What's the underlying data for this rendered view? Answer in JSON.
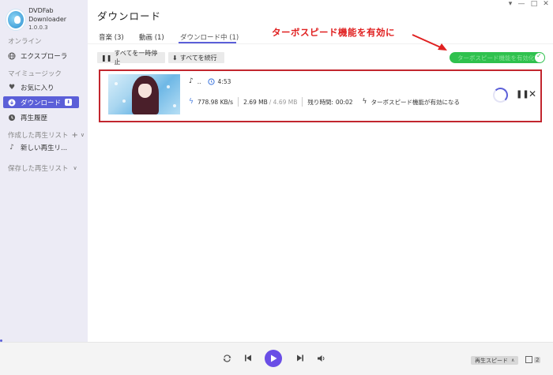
{
  "app": {
    "name": "DVDFab Downloader",
    "version": "1.0.0.3"
  },
  "window_controls": [
    "▾",
    "—",
    "□",
    "✕"
  ],
  "sidebar": {
    "online_title": "オンライン",
    "explorer_label": "エクスプローラ",
    "my_music_title": "マイミュージック",
    "favorites_label": "お気に入り",
    "download_label": "ダウンロード",
    "download_badge": "⬇",
    "history_label": "再生履歴",
    "created_playlists_title": "作成した再生リスト",
    "new_playlist_label": "新しい再生リ...",
    "saved_playlists_title": "保存した再生リスト"
  },
  "main": {
    "title": "ダウンロード",
    "tabs": [
      {
        "label": "音楽 (3)"
      },
      {
        "label": "動画 (1)"
      },
      {
        "label": "ダウンロード中 (1)"
      }
    ],
    "pause_all_label": "すべてを一時停止",
    "resume_all_label": "すべてを続行",
    "turbo_toggle_text": "ターボスピード機能を有効化",
    "annotation": "ターボスピード機能を有効に"
  },
  "download_item": {
    "name": "..",
    "duration": "4:53",
    "speed": "778.98 KB/s",
    "size_done": "2.69 MB",
    "size_total": "/ 4.69 MB",
    "remaining_label": "残り時間:",
    "remaining_time": "00:02",
    "turbo_status": "ターボスピード機能が有効になる",
    "progress": 0.57
  },
  "player": {
    "speed_label": "再生スピード",
    "queue_count": "2"
  },
  "colors": {
    "accent": "#5b5fd8",
    "turbo_green": "#2fc14e",
    "annotation_red": "#e02020",
    "sidebar_bg": "#ecebf5"
  }
}
